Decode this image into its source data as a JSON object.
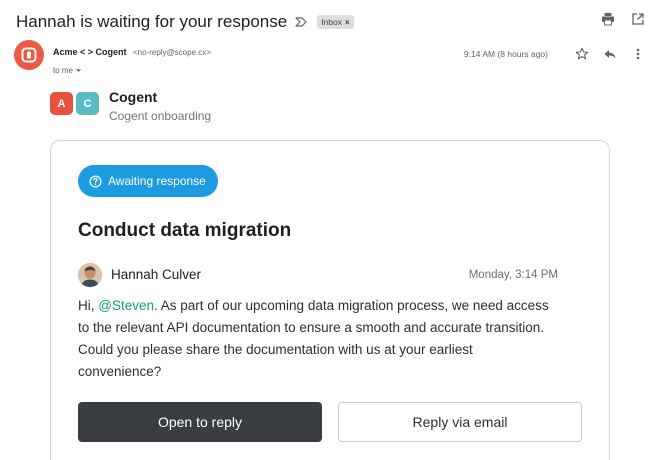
{
  "header": {
    "subject": "Hannah is waiting for your response",
    "label": "Inbox",
    "label_remove": "×"
  },
  "sender": {
    "name": "Acme < > Cogent",
    "email": "<no-reply@scope.cx>",
    "to": "to me",
    "timestamp": "9:14 AM (8 hours ago)"
  },
  "brand": {
    "logo_left": "A",
    "logo_right": "C",
    "name": "Cogent",
    "subtitle": "Cogent onboarding"
  },
  "card": {
    "status": "Awaiting response",
    "title": "Conduct data migration",
    "author": "Hannah Culver",
    "time": "Monday, 3:14 PM",
    "body_prefix": "Hi, ",
    "mention": "@Steven",
    "body_rest": ". As part of our upcoming data migration process, we need access to the relevant API documentation to ensure a smooth and accurate transition. Could you please share the documentation with us at your earliest convenience?",
    "primary_button": "Open to reply",
    "secondary_button": "Reply via email"
  },
  "colors": {
    "accent": "#1c9be0",
    "avatar": "#ea5a45",
    "mention": "#1a9b7a",
    "primary_button": "#3a3e42"
  },
  "icons": [
    "important-icon",
    "print-icon",
    "open-in-new-window-icon",
    "app-logo-icon",
    "chevron-down-icon",
    "star-icon",
    "reply-icon",
    "more-vertical-icon",
    "help-circle-icon"
  ]
}
